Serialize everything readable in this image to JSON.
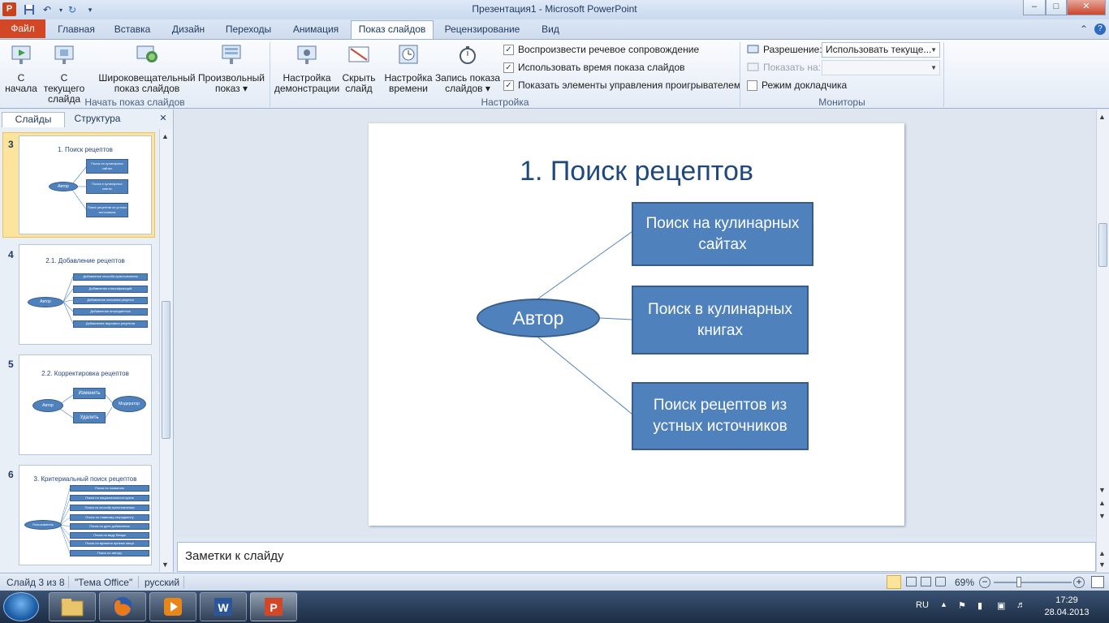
{
  "window": {
    "title": "Презентация1  -  Microsoft PowerPoint",
    "app_icon_letter": "P",
    "min_glyph": "–",
    "max_glyph": "□",
    "close_glyph": "✕"
  },
  "ribbon_tabs": {
    "file": "Файл",
    "items": [
      "Главная",
      "Вставка",
      "Дизайн",
      "Переходы",
      "Анимация",
      "Показ слайдов",
      "Рецензирование",
      "Вид"
    ],
    "active": "Показ слайдов"
  },
  "ribbon": {
    "group1": {
      "label": "Начать показ слайдов",
      "buttons": [
        {
          "label": "С\nначала"
        },
        {
          "label": "С текущего\nслайда"
        },
        {
          "label": "Широковещательный\nпоказ слайдов"
        },
        {
          "label": "Произвольный\nпоказ ▾"
        }
      ]
    },
    "group2": {
      "label": "Настройка",
      "buttons": [
        {
          "label": "Настройка\nдемонстрации"
        },
        {
          "label": "Скрыть\nслайд"
        },
        {
          "label": "Настройка\nвремени"
        },
        {
          "label": "Запись показа\nслайдов ▾"
        }
      ],
      "checkboxes": [
        {
          "label": "Воспроизвести речевое сопровождение",
          "checked": true
        },
        {
          "label": "Использовать время показа слайдов",
          "checked": true
        },
        {
          "label": "Показать элементы управления проигрывателем",
          "checked": true
        }
      ]
    },
    "group3": {
      "label": "Мониторы",
      "resolution_label": "Разрешение:",
      "resolution_value": "Использовать текуще...",
      "show_on_label": "Показать на:",
      "presenter_view_label": "Режим докладчика",
      "presenter_view_checked": false
    }
  },
  "left_pane": {
    "tabs": [
      "Слайды",
      "Структура"
    ],
    "active_tab": "Слайды",
    "close_glyph": "✕",
    "thumbnails": [
      {
        "number": "3",
        "title": "1. Поиск рецептов",
        "selected": true,
        "oval": "Автор",
        "boxes": [
          "Поиск на кулинарных сайтах",
          "Поиск в кулинарных книгах",
          "Поиск рецептов из устных источников"
        ]
      },
      {
        "number": "4",
        "title": "2.1. Добавление рецептов",
        "selected": false,
        "oval": "Автор",
        "boxes": [
          "Добавление способа приготовления",
          "Добавление классификаций",
          "Добавление описания рецепта",
          "Добавление ингредиентов",
          "Добавление вкусового рецептов"
        ]
      },
      {
        "number": "5",
        "title": "2.2. Корректировка рецептов",
        "selected": false,
        "oval": "Автор",
        "oval2": "Модератор",
        "boxes": [
          "Изменить",
          "Удалить"
        ]
      },
      {
        "number": "6",
        "title": "3. Критериальный поиск рецептов",
        "selected": false,
        "oval": "Пользователь",
        "boxes": [
          "Поиск по названию",
          "Поиск по национальности кухни",
          "Поиск по способу приготовления",
          "Поиск по главному ингредиенту",
          "Поиск по дате добавления",
          "Поиск по виду блюда",
          "Поиск по времени приема пищи",
          "Поиск по автору"
        ]
      }
    ]
  },
  "slide": {
    "title": "1. Поиск рецептов",
    "center": "Автор",
    "boxes": [
      "Поиск на кулинарных сайтах",
      "Поиск в кулинарных книгах",
      "Поиск рецептов из устных источников"
    ]
  },
  "notes": {
    "placeholder": "Заметки к слайду"
  },
  "status": {
    "slide_info": "Слайд 3 из 8",
    "theme": "\"Тема Office\"",
    "language": "русский",
    "zoom": "69%",
    "zoom_level": 0.69
  },
  "taskbar": {
    "lang": "RU",
    "time": "17:29",
    "date": "28.04.2013"
  },
  "colors": {
    "accent": "#4f81bd",
    "title_blue": "#1f497d",
    "file_tab": "#d24726"
  }
}
